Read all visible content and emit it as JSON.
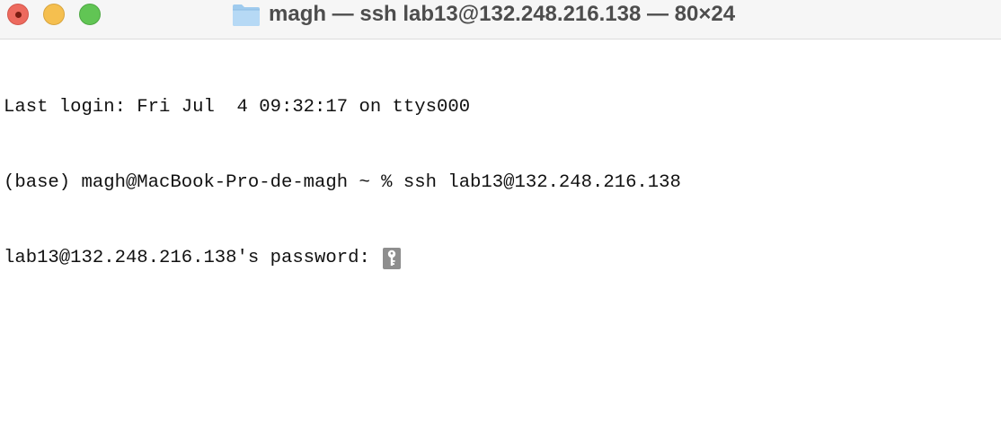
{
  "window": {
    "title": "magh — ssh lab13@132.248.216.138 — 80×24"
  },
  "icons": {
    "title_icon": "folder-icon",
    "cursor_icon": "key-icon"
  },
  "colors": {
    "close": "#ed6a5e",
    "minimize": "#f5bf4f",
    "zoom": "#61c554",
    "titlebar": "#f6f6f6",
    "text": "#111111"
  },
  "terminal": {
    "lines": [
      "Last login: Fri Jul  4 09:32:17 on ttys000",
      "(base) magh@MacBook-Pro-de-magh ~ % ssh lab13@132.248.216.138",
      "lab13@132.248.216.138's password: "
    ]
  }
}
